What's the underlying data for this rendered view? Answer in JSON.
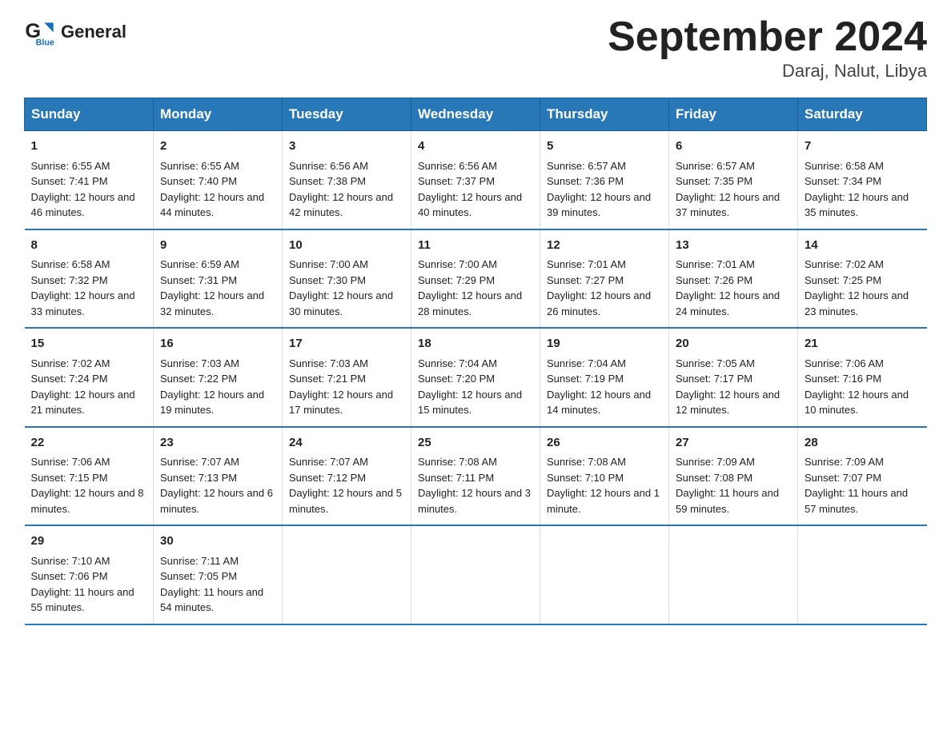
{
  "header": {
    "logo_text1": "General",
    "logo_text2": "Blue",
    "month_year": "September 2024",
    "location": "Daraj, Nalut, Libya"
  },
  "days_of_week": [
    "Sunday",
    "Monday",
    "Tuesday",
    "Wednesday",
    "Thursday",
    "Friday",
    "Saturday"
  ],
  "weeks": [
    [
      {
        "day": "1",
        "sunrise": "6:55 AM",
        "sunset": "7:41 PM",
        "daylight": "12 hours and 46 minutes."
      },
      {
        "day": "2",
        "sunrise": "6:55 AM",
        "sunset": "7:40 PM",
        "daylight": "12 hours and 44 minutes."
      },
      {
        "day": "3",
        "sunrise": "6:56 AM",
        "sunset": "7:38 PM",
        "daylight": "12 hours and 42 minutes."
      },
      {
        "day": "4",
        "sunrise": "6:56 AM",
        "sunset": "7:37 PM",
        "daylight": "12 hours and 40 minutes."
      },
      {
        "day": "5",
        "sunrise": "6:57 AM",
        "sunset": "7:36 PM",
        "daylight": "12 hours and 39 minutes."
      },
      {
        "day": "6",
        "sunrise": "6:57 AM",
        "sunset": "7:35 PM",
        "daylight": "12 hours and 37 minutes."
      },
      {
        "day": "7",
        "sunrise": "6:58 AM",
        "sunset": "7:34 PM",
        "daylight": "12 hours and 35 minutes."
      }
    ],
    [
      {
        "day": "8",
        "sunrise": "6:58 AM",
        "sunset": "7:32 PM",
        "daylight": "12 hours and 33 minutes."
      },
      {
        "day": "9",
        "sunrise": "6:59 AM",
        "sunset": "7:31 PM",
        "daylight": "12 hours and 32 minutes."
      },
      {
        "day": "10",
        "sunrise": "7:00 AM",
        "sunset": "7:30 PM",
        "daylight": "12 hours and 30 minutes."
      },
      {
        "day": "11",
        "sunrise": "7:00 AM",
        "sunset": "7:29 PM",
        "daylight": "12 hours and 28 minutes."
      },
      {
        "day": "12",
        "sunrise": "7:01 AM",
        "sunset": "7:27 PM",
        "daylight": "12 hours and 26 minutes."
      },
      {
        "day": "13",
        "sunrise": "7:01 AM",
        "sunset": "7:26 PM",
        "daylight": "12 hours and 24 minutes."
      },
      {
        "day": "14",
        "sunrise": "7:02 AM",
        "sunset": "7:25 PM",
        "daylight": "12 hours and 23 minutes."
      }
    ],
    [
      {
        "day": "15",
        "sunrise": "7:02 AM",
        "sunset": "7:24 PM",
        "daylight": "12 hours and 21 minutes."
      },
      {
        "day": "16",
        "sunrise": "7:03 AM",
        "sunset": "7:22 PM",
        "daylight": "12 hours and 19 minutes."
      },
      {
        "day": "17",
        "sunrise": "7:03 AM",
        "sunset": "7:21 PM",
        "daylight": "12 hours and 17 minutes."
      },
      {
        "day": "18",
        "sunrise": "7:04 AM",
        "sunset": "7:20 PM",
        "daylight": "12 hours and 15 minutes."
      },
      {
        "day": "19",
        "sunrise": "7:04 AM",
        "sunset": "7:19 PM",
        "daylight": "12 hours and 14 minutes."
      },
      {
        "day": "20",
        "sunrise": "7:05 AM",
        "sunset": "7:17 PM",
        "daylight": "12 hours and 12 minutes."
      },
      {
        "day": "21",
        "sunrise": "7:06 AM",
        "sunset": "7:16 PM",
        "daylight": "12 hours and 10 minutes."
      }
    ],
    [
      {
        "day": "22",
        "sunrise": "7:06 AM",
        "sunset": "7:15 PM",
        "daylight": "12 hours and 8 minutes."
      },
      {
        "day": "23",
        "sunrise": "7:07 AM",
        "sunset": "7:13 PM",
        "daylight": "12 hours and 6 minutes."
      },
      {
        "day": "24",
        "sunrise": "7:07 AM",
        "sunset": "7:12 PM",
        "daylight": "12 hours and 5 minutes."
      },
      {
        "day": "25",
        "sunrise": "7:08 AM",
        "sunset": "7:11 PM",
        "daylight": "12 hours and 3 minutes."
      },
      {
        "day": "26",
        "sunrise": "7:08 AM",
        "sunset": "7:10 PM",
        "daylight": "12 hours and 1 minute."
      },
      {
        "day": "27",
        "sunrise": "7:09 AM",
        "sunset": "7:08 PM",
        "daylight": "11 hours and 59 minutes."
      },
      {
        "day": "28",
        "sunrise": "7:09 AM",
        "sunset": "7:07 PM",
        "daylight": "11 hours and 57 minutes."
      }
    ],
    [
      {
        "day": "29",
        "sunrise": "7:10 AM",
        "sunset": "7:06 PM",
        "daylight": "11 hours and 55 minutes."
      },
      {
        "day": "30",
        "sunrise": "7:11 AM",
        "sunset": "7:05 PM",
        "daylight": "11 hours and 54 minutes."
      },
      {
        "day": "",
        "sunrise": "",
        "sunset": "",
        "daylight": ""
      },
      {
        "day": "",
        "sunrise": "",
        "sunset": "",
        "daylight": ""
      },
      {
        "day": "",
        "sunrise": "",
        "sunset": "",
        "daylight": ""
      },
      {
        "day": "",
        "sunrise": "",
        "sunset": "",
        "daylight": ""
      },
      {
        "day": "",
        "sunrise": "",
        "sunset": "",
        "daylight": ""
      }
    ]
  ]
}
